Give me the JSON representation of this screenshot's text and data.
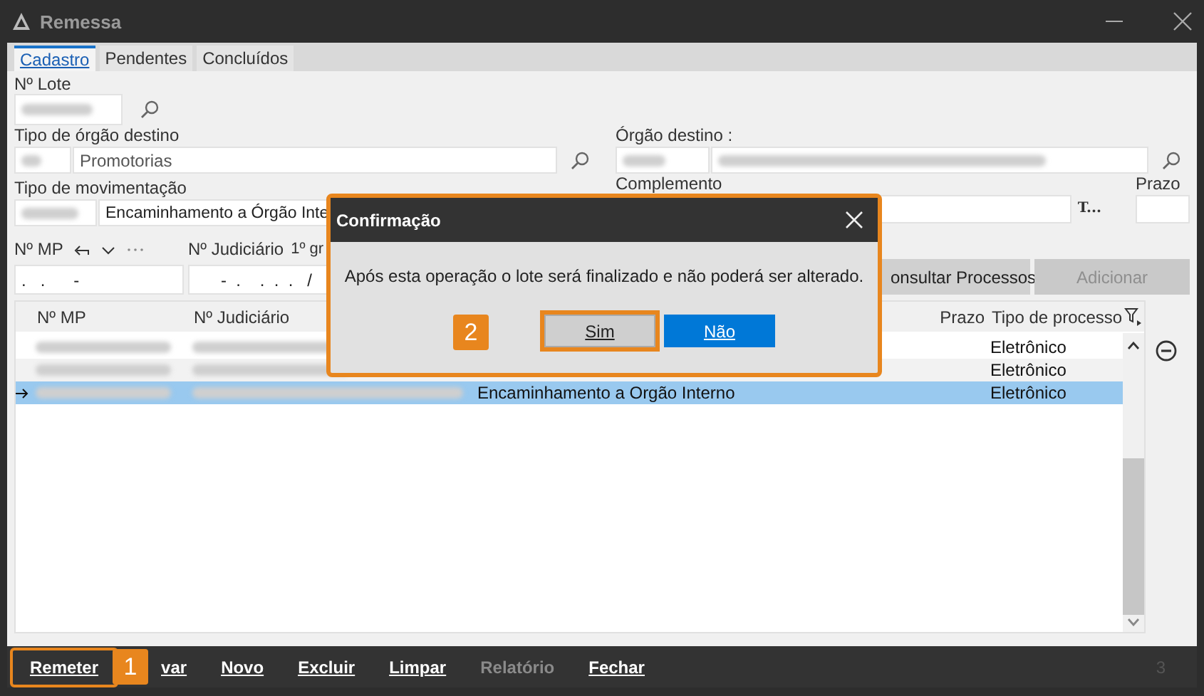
{
  "window": {
    "title": "Remessa"
  },
  "tabs": [
    {
      "label": "Cadastro",
      "selected": true
    },
    {
      "label": "Pendentes",
      "selected": false
    },
    {
      "label": "Concluídos",
      "selected": false
    }
  ],
  "form": {
    "lote_label": "Nº Lote",
    "tipo_orgao_label": "Tipo de órgão destino",
    "tipo_orgao_name": "Promotorias",
    "orgao_destino_label": "Órgão destino :",
    "tipo_mov_label": "Tipo de movimentação",
    "tipo_mov_name": "Encaminhamento a Órgão Inte",
    "complemento_label": "Complemento",
    "t_label": "T...",
    "prazo_label": "Prazo",
    "mp_label": "Nº MP",
    "mp_value": ".   .      -",
    "judiciario_label": "Nº Judiciário",
    "judiciario_value": "-  .    .  .  .   /",
    "grau_label": "1º gr"
  },
  "actions": [
    {
      "label": "onsultar Processos",
      "disabled": false
    },
    {
      "label": "Adicionar",
      "disabled": true
    }
  ],
  "table": {
    "columns": [
      {
        "label": "Nº MP"
      },
      {
        "label": "Nº Judiciário"
      },
      {
        "label": "Prazo"
      },
      {
        "label": "Tipo de processo"
      }
    ],
    "rows": [
      {
        "column_3": "",
        "tipo": "Eletrônico",
        "selected": false
      },
      {
        "column_3": "",
        "tipo": "Eletrônico",
        "selected": false
      },
      {
        "column_3": "Encaminhamento a Orgão Interno",
        "tipo": "Eletrônico",
        "selected": true
      }
    ]
  },
  "bottom_bar": {
    "buttons": [
      {
        "label": "Remeter",
        "disabled": false,
        "highlighted": true
      },
      {
        "label": "var",
        "disabled": false,
        "highlighted": false
      },
      {
        "label": "Novo",
        "disabled": false,
        "highlighted": false
      },
      {
        "label": "Excluir",
        "disabled": false,
        "highlighted": false
      },
      {
        "label": "Limpar",
        "disabled": false,
        "highlighted": false
      },
      {
        "label": "Relatório",
        "disabled": true,
        "highlighted": false
      },
      {
        "label": "Fechar",
        "disabled": false,
        "highlighted": false
      }
    ],
    "page": "3",
    "callout": "1"
  },
  "dialog": {
    "title": "Confirmação",
    "message": "Após esta operação o lote será finalizado e não poderá ser alterado.",
    "buttons": [
      {
        "label": "Sim",
        "highlighted": true,
        "primary": false
      },
      {
        "label": "Não",
        "highlighted": false,
        "primary": true
      }
    ],
    "callout": "2"
  }
}
